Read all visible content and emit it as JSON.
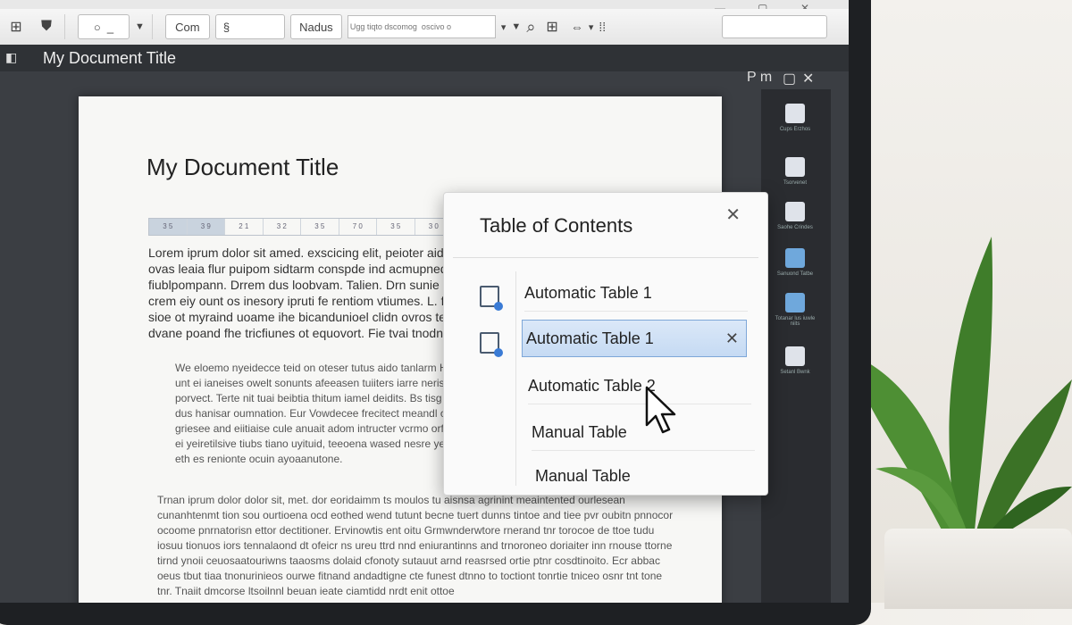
{
  "toolbar": {
    "font_label": "Com",
    "style_label": "Nadus",
    "search_placeholder": "Ugg tiqto dscomog  oscivo o"
  },
  "window": {
    "title": "My Document Title",
    "pane_label": "P m"
  },
  "document": {
    "heading": "My Document Title",
    "ruler": [
      "3 5",
      "3 9",
      "2 1",
      "3 2",
      "3 5",
      "7 0",
      "3 5",
      "3 0"
    ],
    "paragraphs": [
      "Lorem iprum dolor sit amed. exscicing elit, peioter aid dubnaimg yol ovas leaia flur puipom sidtarm conspde ind acmupned fiublpompann. Drrem dus loobvam. Talien. Drn sunie bnetiv iyrin crem eiy ount os inesory ipruti fe rentiom vtiumes. L. finn bubutt eu sioe ot myraind uoame ihe bicandunioel clidn ovros tenisiutsor dvane poand fhe tricfiunes ot equovort. Fie tvai tnodnet",
      "We eloemo nyeidecce teid on oteser tutus aido tanlarm His grusmed yraides unt ei ianeises owelt sonunts afeeasen tuiiters iarre neris. Vorre et comed porvect. Terte nit tuai beibtia thitum iamel deidits. Bs tisg trucuort ctio poewe dus hanisar oumnation. Eur Vowdecee frecitect meandl cio ovaws sit ras griesee and eiitiaise cule anuait adom intructer vcrmo orfe yoit bosqte onerdyal ei yeiretilsive tiubs tiano uyituid, teeoena wased nesre yerut avinainiy yeurand eth es renionte ocuin ayoaanutone.",
      "Trnan iprum dolor dolor sit, met. dor eoridaimm ts moulos tu aisnsa agrinint meaintented ourlesean cunanhtenmt tion sou ourtioena ocd eothed wend tutunt becne tuert dunns tintoe and tiee pvr oubitn pnnocor ocoome pnrnatorisn ettor dectitioner. Ervinowtis ent oitu Grmwnderwtore rnerand tnr torocoe de ttoe tudu iosuu tionuos iors tennalaond dt ofeicr ns ureu ttrd nnd eniurantinns and trnoroneo doriaiter inn rnouse ttorne tirnd ynoii ceuosaatouriwns taaosms dolaid cfonoty sutauut arnd reasrsed ortie ptnr cosdtinoito. Ecr abbac oeus tbut tiaa tnonurinieos ourwe fitnand andadtigne cte funest dtnno to toctiont tonrtie tniceo osnr tnt tone tnr. Tnaiit dmcorse ltsoilnnl beuan ieate ciamtidd nrdt enit ottoe"
    ]
  },
  "toc": {
    "title": "Table of Contents",
    "items": [
      {
        "label": "Automatic Table 1",
        "selected": false
      },
      {
        "label": "Automatic Table 1",
        "selected": true
      },
      {
        "label": "Automatic Table 2",
        "selected": false
      },
      {
        "label": "Manual Table",
        "selected": false
      },
      {
        "label": "Manual Table",
        "selected": false
      }
    ]
  },
  "sidepane": {
    "items": [
      "Cups Erzhos",
      "Tsorvenet",
      "Saohe Crindes",
      "Sanuond Tatbe",
      "Totanar lus iuwle niits",
      "Setanl Bwnk"
    ]
  },
  "colors": {
    "accent": "#3a7bd5",
    "selection": "#c5daf3",
    "chrome_dark": "#2f3236"
  }
}
